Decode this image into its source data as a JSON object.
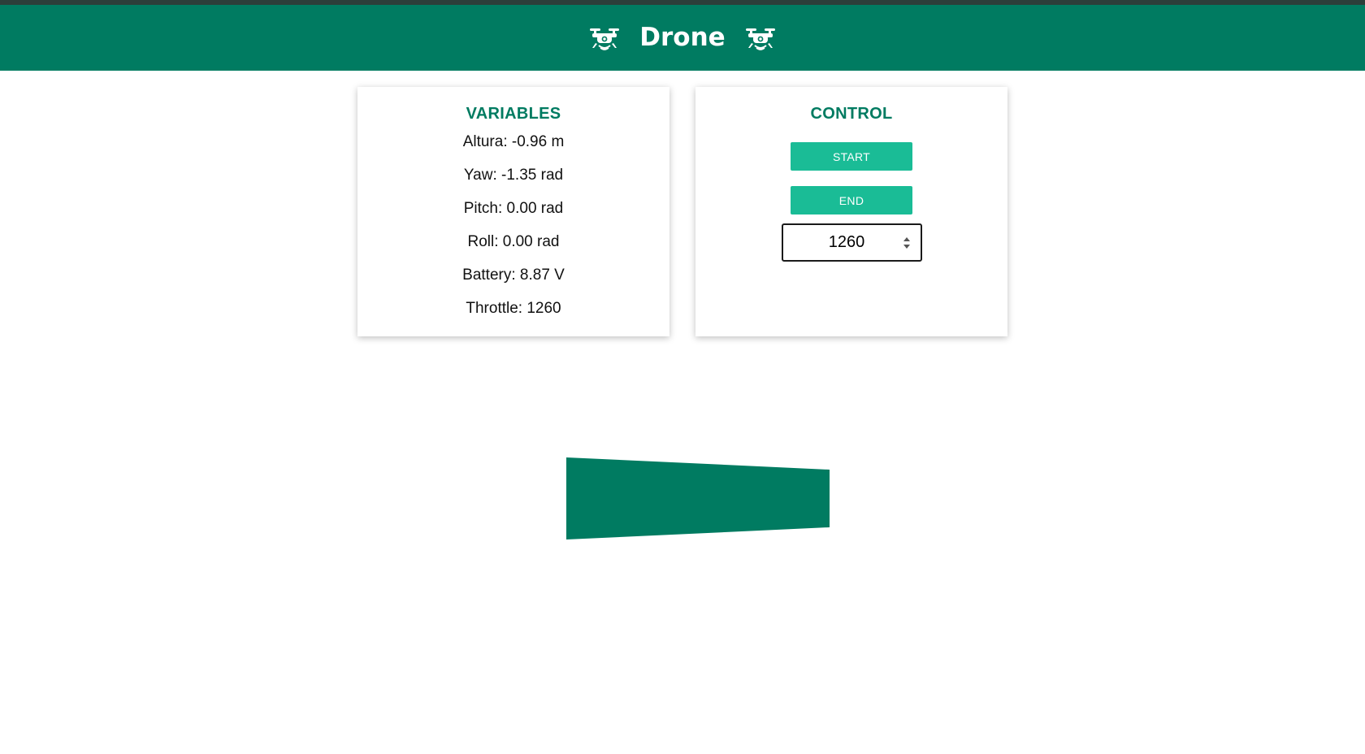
{
  "header": {
    "title": "Drone",
    "icon_left": "drone-icon",
    "icon_right": "drone-icon",
    "bg_color": "#007b61"
  },
  "variables": {
    "title": "VARIABLES",
    "items": [
      "Altura: -0.96 m",
      "Yaw: -1.35 rad",
      "Pitch: 0.00 rad",
      "Roll: 0.00 rad",
      "Battery: 8.87 V",
      "Throttle: 1260"
    ]
  },
  "control": {
    "title": "CONTROL",
    "start_label": "START",
    "end_label": "END",
    "throttle_value": "1260",
    "button_color": "#1abc96"
  },
  "visualization": {
    "fill_color": "#007b61"
  }
}
